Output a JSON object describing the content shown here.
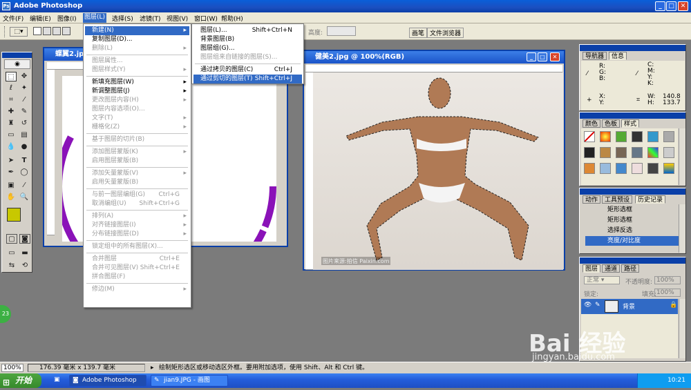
{
  "app_title": "Adobe Photoshop",
  "menubar": [
    "文件(F)",
    "编辑(E)",
    "图像(I)",
    "图层(L)",
    "选择(S)",
    "滤镜(T)",
    "视图(V)",
    "窗口(W)",
    "帮助(H)"
  ],
  "options": {
    "height_label": "高度:",
    "tab_brushes": "画笔",
    "tab_browser": "文件浏览器"
  },
  "doc_left_title": "蝶翼2.jpg @",
  "doc_right_title": "健美2.jpg @ 100%(RGB)",
  "photo_credit": "图片来源:拍信 Paixin.com",
  "layer_menu": [
    {
      "label": "新建(N)",
      "arrow": "▸",
      "state": "hl"
    },
    {
      "label": "复制图层(D)...",
      "state": ""
    },
    {
      "label": "删除(L)",
      "arrow": "▸",
      "state": "dis"
    },
    {
      "sep": true
    },
    {
      "label": "图层属性...",
      "state": "dis"
    },
    {
      "label": "图层样式(Y)",
      "arrow": "▸",
      "state": "dis"
    },
    {
      "sep": true
    },
    {
      "label": "新填充图层(W)",
      "arrow": "▸",
      "state": ""
    },
    {
      "label": "新调整图层(J)",
      "arrow": "▸",
      "state": ""
    },
    {
      "label": "更改图层内容(H)",
      "arrow": "▸",
      "state": "dis"
    },
    {
      "label": "图层内容选项(O)...",
      "state": "dis"
    },
    {
      "label": "文字(T)",
      "arrow": "▸",
      "state": "dis"
    },
    {
      "label": "栅格化(Z)",
      "arrow": "▸",
      "state": "dis"
    },
    {
      "sep": true
    },
    {
      "label": "基于图层的切片(B)",
      "state": "dis"
    },
    {
      "sep": true
    },
    {
      "label": "添加图层蒙版(K)",
      "arrow": "▸",
      "state": "dis"
    },
    {
      "label": "启用图层蒙版(B)",
      "state": "dis"
    },
    {
      "sep": true
    },
    {
      "label": "添加矢量蒙版(V)",
      "arrow": "▸",
      "state": "dis"
    },
    {
      "label": "启用矢量蒙版(B)",
      "state": "dis"
    },
    {
      "sep": true
    },
    {
      "label": "与前一图层编组(G)",
      "shortcut": "Ctrl+G",
      "state": "dis"
    },
    {
      "label": "取消编组(U)",
      "shortcut": "Shift+Ctrl+G",
      "state": "dis"
    },
    {
      "sep": true
    },
    {
      "label": "排列(A)",
      "arrow": "▸",
      "state": "dis"
    },
    {
      "label": "对齐链接图层(I)",
      "arrow": "▸",
      "state": "dis"
    },
    {
      "label": "分布链接图层(D)",
      "arrow": "▸",
      "state": "dis"
    },
    {
      "sep": true
    },
    {
      "label": "锁定组中的所有图层(X)...",
      "state": "dis"
    },
    {
      "sep": true
    },
    {
      "label": "合并图层",
      "shortcut": "Ctrl+E",
      "state": "dis"
    },
    {
      "label": "合并可见图层(V)",
      "shortcut": "Shift+Ctrl+E",
      "state": "dis"
    },
    {
      "label": "拼合图层(F)",
      "state": "dis"
    },
    {
      "sep": true
    },
    {
      "label": "修边(M)",
      "arrow": "▸",
      "state": "dis"
    }
  ],
  "new_submenu": [
    {
      "label": "图层(L)...",
      "shortcut": "Shift+Ctrl+N",
      "state": ""
    },
    {
      "label": "背景图层(B)",
      "state": ""
    },
    {
      "label": "图层组(G)...",
      "state": ""
    },
    {
      "label": "图层组来自链接的图层(S)...",
      "state": "dis"
    },
    {
      "sep": true
    },
    {
      "label": "通过拷贝的图层(C)",
      "shortcut": "Ctrl+J",
      "state": ""
    },
    {
      "label": "通过剪切的图层(T)",
      "shortcut": "Shift+Ctrl+J",
      "state": "hl"
    }
  ],
  "info_panel": {
    "tabs": [
      "导航器",
      "信息"
    ],
    "labels": [
      "R:",
      "G:",
      "B:",
      "C:",
      "M:",
      "Y:",
      "K:",
      "X:",
      "Y:",
      "W:",
      "H:"
    ],
    "w": "140.8",
    "h": "133.7"
  },
  "color_panel": {
    "tabs": [
      "颜色",
      "色板",
      "样式"
    ]
  },
  "history_panel": {
    "tabs": [
      "动作",
      "工具预设",
      "历史记录"
    ],
    "items": [
      "矩形选框",
      "矩形选框",
      "选择反选",
      "亮度/对比度"
    ]
  },
  "layers_panel": {
    "tabs": [
      "图层",
      "通道",
      "路径"
    ],
    "blend": "正常",
    "opacity_label": "不透明度:",
    "opacity": "100%",
    "lock_label": "锁定:",
    "fill_label": "填充:",
    "fill": "100%",
    "layer_name": "背景"
  },
  "status": {
    "zoom": "100%",
    "size": "176.39 毫米 x 139.7 毫米",
    "hint": "绘制矩形选区或移动选区外框。要用附加选项，使用 Shift、Alt 和 Ctrl 键。"
  },
  "taskbar": {
    "start": "开始",
    "items": [
      "Adobe Photoshop",
      "jian9.JPG - 画图"
    ],
    "time": "10:21"
  },
  "badge": "23",
  "watermark": {
    "brand": "Bai 经验",
    "url": "jingyan.baidu.com"
  },
  "colors": {
    "fg": "#c8c800",
    "bg": "#0000cc",
    "accent": "#316ac5"
  }
}
